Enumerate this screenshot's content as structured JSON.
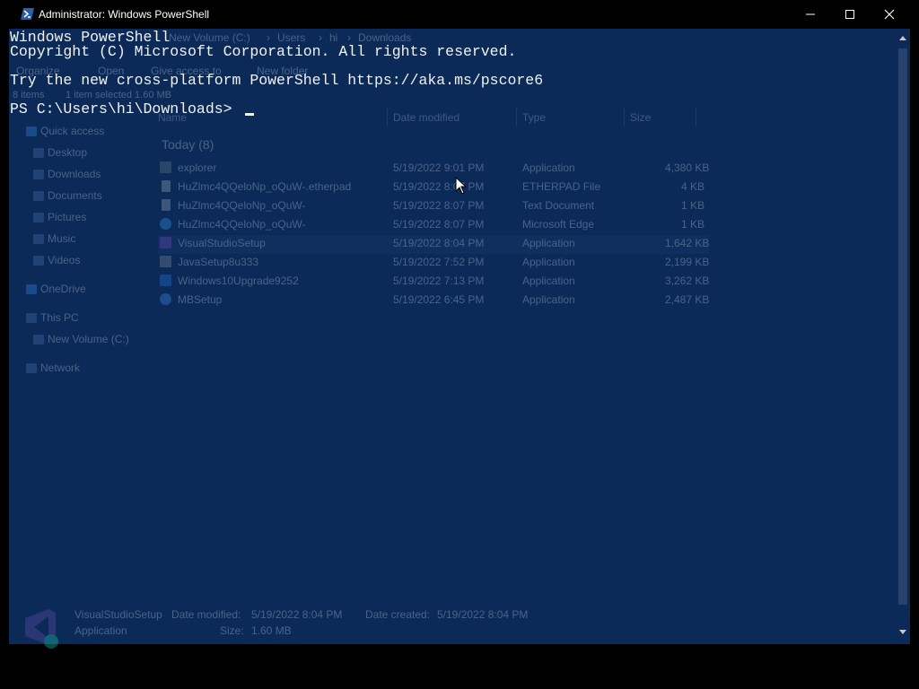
{
  "titlebar": {
    "title": "Administrator: Windows PowerShell"
  },
  "console": {
    "lines": [
      "Windows PowerShell",
      "Copyright (C) Microsoft Corporation. All rights reserved.",
      "",
      "Try the new cross-platform PowerShell https://aka.ms/pscore6",
      "",
      "PS C:\\Users\\hi\\Downloads> "
    ]
  },
  "explorer": {
    "breadcrumb": [
      "New Volume (C:)",
      "Users",
      "hi",
      "Downloads"
    ],
    "toolbar": [
      "Organize",
      "Open",
      "Give access to",
      "New folder"
    ],
    "status": {
      "items": "8 items",
      "selected": "1 item selected  1.60 MB"
    },
    "columns": {
      "name": "Name",
      "date": "Date modified",
      "type": "Type",
      "size": "Size"
    },
    "group": "Today (8)",
    "nav": [
      {
        "label": "Quick access"
      },
      {
        "label": "Desktop"
      },
      {
        "label": "Downloads"
      },
      {
        "label": "Documents"
      },
      {
        "label": "Pictures"
      },
      {
        "label": "Music"
      },
      {
        "label": "Videos"
      },
      {
        "label": "OneDrive"
      },
      {
        "label": "This PC"
      },
      {
        "label": "New Volume (C:)"
      },
      {
        "label": "Network"
      }
    ],
    "files": [
      {
        "name": "explorer",
        "date": "5/19/2022 9:01 PM",
        "type": "Application",
        "size": "4,380 KB",
        "icon_color": "#5b6d86"
      },
      {
        "name": "HuZlmc4QQeloNp_oQuW-.etherpad",
        "date": "5/19/2022 8:07 PM",
        "type": "ETHERPAD File",
        "size": "4 KB",
        "icon_color": "#8a98ad"
      },
      {
        "name": "HuZlmc4QQeloNp_oQuW-",
        "date": "5/19/2022 8:07 PM",
        "type": "Text Document",
        "size": "1 KB",
        "icon_color": "#8a98ad"
      },
      {
        "name": "HuZlmc4QQeloNp_oQuW-",
        "date": "5/19/2022 8:07 PM",
        "type": "Microsoft Edge",
        "size": "1 KB",
        "icon_color": "#2f8fd6"
      },
      {
        "name": "VisualStudioSetup",
        "date": "5/19/2022 8:04 PM",
        "type": "Application",
        "size": "1,642 KB",
        "icon_color": "#6a4fb6"
      },
      {
        "name": "JavaSetup8u333",
        "date": "5/19/2022 7:52 PM",
        "type": "Application",
        "size": "2,199 KB",
        "icon_color": "#6f7f96"
      },
      {
        "name": "Windows10Upgrade9252",
        "date": "5/19/2022 7:13 PM",
        "type": "Application",
        "size": "3,262 KB",
        "icon_color": "#1f6fd0"
      },
      {
        "name": "MBSetup",
        "date": "5/19/2022 6:45 PM",
        "type": "Application",
        "size": "2,487 KB",
        "icon_color": "#3f7fd8"
      }
    ],
    "details": {
      "name": "VisualStudioSetup",
      "kind": "Application",
      "modified_label": "Date modified:",
      "modified": "5/19/2022 8:04 PM",
      "created_label": "Date created:",
      "created": "5/19/2022 8:04 PM",
      "size_label": "Size:",
      "size": "1.60 MB"
    }
  },
  "colors": {
    "console_bg": "#0b2a57",
    "console_fg": "#f2f2f2",
    "titlebar_bg": "#000000"
  }
}
